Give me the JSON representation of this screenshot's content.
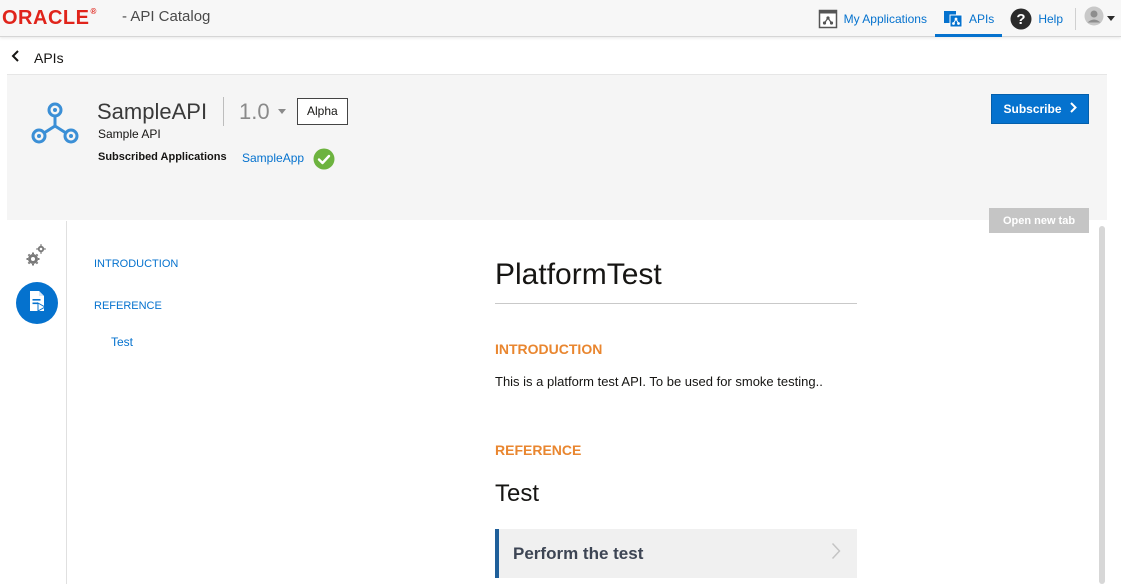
{
  "topbar": {
    "brand": "ORACLE",
    "brand_reg": "®",
    "app_title": "- API Catalog",
    "nav": {
      "my_applications": "My Applications",
      "apis": "APIs",
      "help": "Help"
    }
  },
  "back": {
    "label": "APIs"
  },
  "api": {
    "name": "SampleAPI",
    "version": "1.0",
    "badge": "Alpha",
    "description": "Sample API",
    "subscribed_label": "Subscribed Applications",
    "subscribed_app": "SampleApp",
    "subscribe_button": "Subscribe"
  },
  "toolbar": {
    "open_new_tab": "Open new tab"
  },
  "toc": {
    "introduction": "INTRODUCTION",
    "reference": "REFERENCE",
    "test": "Test"
  },
  "content": {
    "title": "PlatformTest",
    "intro_heading": "INTRODUCTION",
    "intro_text": "This is a platform test API. To be used for smoke testing..",
    "reference_heading": "REFERENCE",
    "test_heading": "Test",
    "perform_label": "Perform the test"
  },
  "colors": {
    "brand_red": "#e0241b",
    "accent_blue": "#0572ce",
    "section_orange": "#e9862f",
    "success_green": "#6db33f"
  },
  "icons": {
    "my_applications": "applications-icon",
    "apis": "apis-icon",
    "help": "help-icon",
    "avatar": "user-avatar-icon",
    "back": "chevron-left-icon",
    "api_logo": "api-network-icon",
    "subscribed": "check-circle-icon",
    "settings": "gears-icon",
    "document": "document-icon",
    "perform": "chevron-right-icon"
  }
}
